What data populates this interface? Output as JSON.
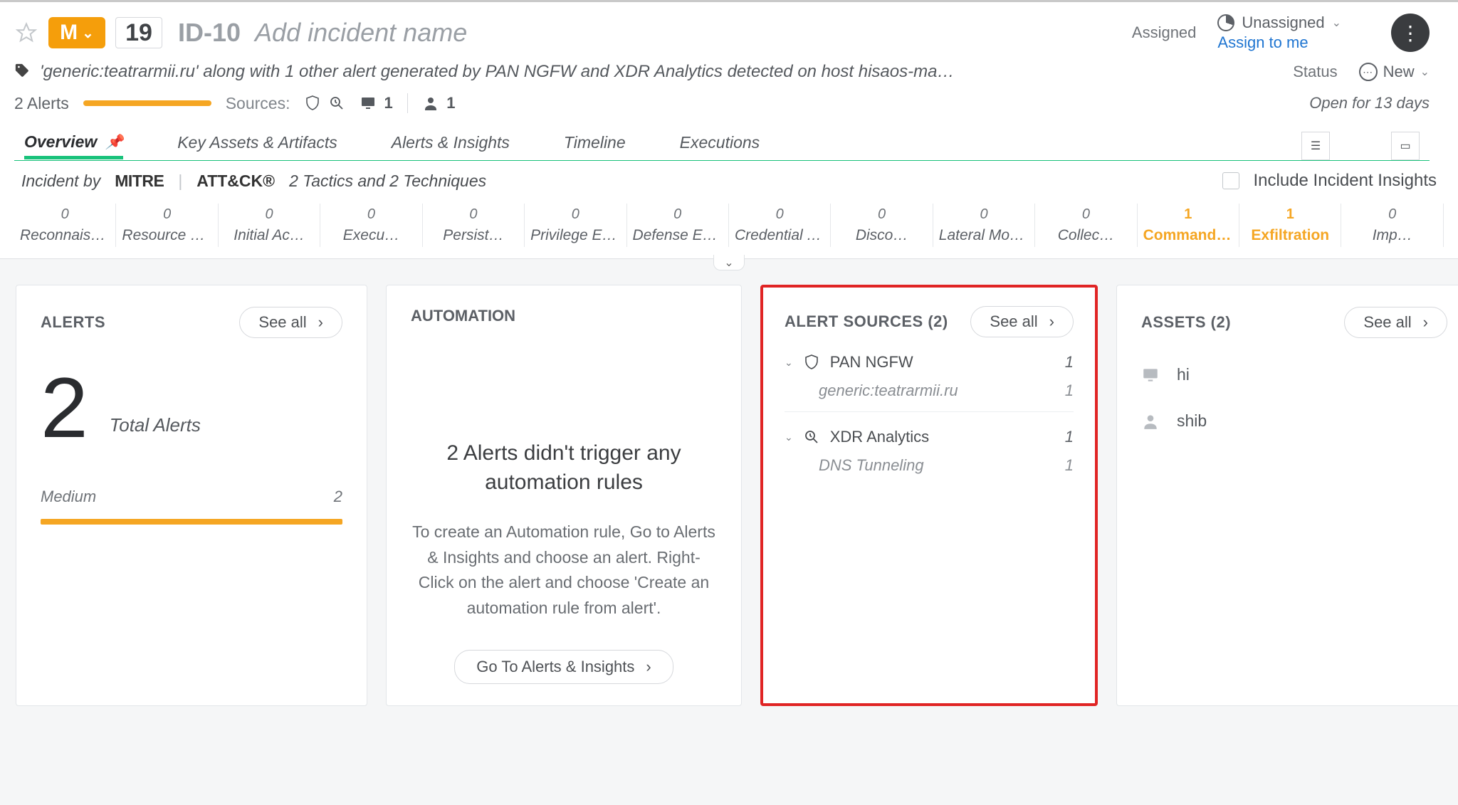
{
  "header": {
    "severity_letter": "M",
    "score": "19",
    "incident_id": "ID-10",
    "name_placeholder": "Add incident name",
    "subline": "'generic:teatrarmii.ru' along with 1 other alert generated by PAN NGFW and XDR Analytics detected on host hisaos-ma…",
    "assigned_label": "Assigned",
    "unassigned": "Unassigned",
    "assign_link": "Assign to me",
    "status_label": "Status",
    "status_value": "New",
    "open_for": "Open for 13 days",
    "alert_count_text": "2 Alerts",
    "sources_label": "Sources:",
    "hosts_count": "1",
    "users_count": "1"
  },
  "tabs": [
    "Overview",
    "Key Assets & Artifacts",
    "Alerts & Insights",
    "Timeline",
    "Executions"
  ],
  "mitre": {
    "prefix": "Incident by",
    "logo1": "MITRE",
    "logo2": "ATT&CK®",
    "stats": "2 Tactics and 2 Techniques",
    "include_label": "Include Incident Insights",
    "tactics": [
      {
        "n": "0",
        "t": "Reconnaiss…",
        "hot": false
      },
      {
        "n": "0",
        "t": "Resource Develo…",
        "hot": false
      },
      {
        "n": "0",
        "t": "Initial Ac…",
        "hot": false
      },
      {
        "n": "0",
        "t": "Execu…",
        "hot": false
      },
      {
        "n": "0",
        "t": "Persist…",
        "hot": false
      },
      {
        "n": "0",
        "t": "Privilege Escal…",
        "hot": false
      },
      {
        "n": "0",
        "t": "Defense Ev…",
        "hot": false
      },
      {
        "n": "0",
        "t": "Credential A…",
        "hot": false
      },
      {
        "n": "0",
        "t": "Disco…",
        "hot": false
      },
      {
        "n": "0",
        "t": "Lateral Move…",
        "hot": false
      },
      {
        "n": "0",
        "t": "Collec…",
        "hot": false
      },
      {
        "n": "1",
        "t": "Command and Control",
        "hot": true
      },
      {
        "n": "1",
        "t": "Exfiltration",
        "hot": true
      },
      {
        "n": "0",
        "t": "Imp…",
        "hot": false
      }
    ]
  },
  "alerts_card": {
    "title": "ALERTS",
    "see_all": "See all",
    "total_number": "2",
    "total_label": "Total Alerts",
    "sev_label": "Medium",
    "sev_count": "2"
  },
  "automation_card": {
    "title": "AUTOMATION",
    "headline": "2 Alerts didn't trigger any automation rules",
    "help": "To create an Automation rule, Go to Alerts & Insights and choose an alert. Right-Click on the alert and choose 'Create an automation rule from alert'.",
    "button": "Go To Alerts & Insights"
  },
  "sources_card": {
    "title": "ALERT SOURCES (2)",
    "see_all": "See all",
    "groups": [
      {
        "name": "PAN NGFW",
        "count": "1",
        "item": {
          "name": "generic:teatrarmii.ru",
          "count": "1"
        }
      },
      {
        "name": "XDR Analytics",
        "count": "1",
        "item": {
          "name": "DNS Tunneling",
          "count": "1"
        }
      }
    ]
  },
  "assets_card": {
    "title": "ASSETS (2)",
    "see_all": "See all",
    "items": [
      {
        "icon": "host",
        "label": "hi"
      },
      {
        "icon": "user",
        "label": "shib"
      }
    ]
  }
}
